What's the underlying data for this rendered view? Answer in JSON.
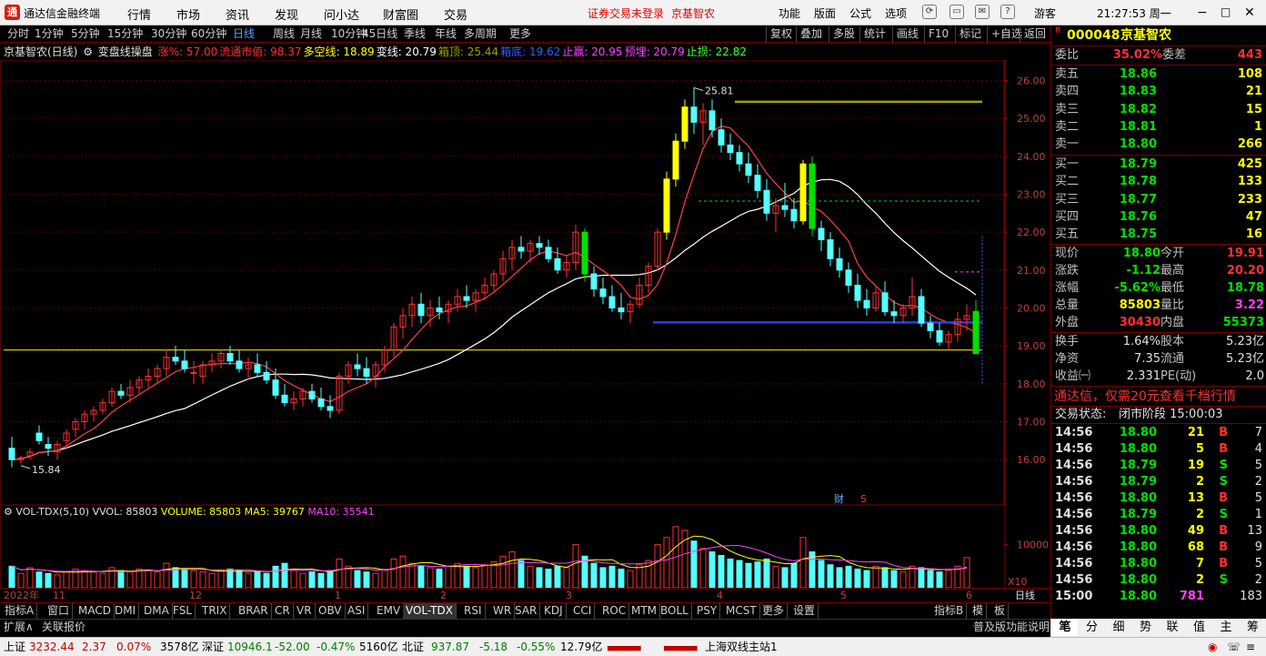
{
  "title_bar": {
    "app_name": "通达信金融终端",
    "menu": [
      "行情",
      "市场",
      "资讯",
      "发现",
      "问小达",
      "财富圈",
      "交易"
    ],
    "login_notice": "证券交易未登录",
    "stock_name": "京基智农",
    "tools": [
      "功能",
      "版面",
      "公式",
      "选项"
    ],
    "user": "游客",
    "clock": "21:27:53 周一"
  },
  "period_bar": {
    "periods": [
      "分时",
      "1分钟",
      "5分钟",
      "15分钟",
      "30分钟",
      "60分钟",
      "日线",
      "周线",
      "月线",
      "10分钟",
      "45日线",
      "季线",
      "年线",
      "多周期",
      "更多"
    ],
    "active": "日线",
    "right_buttons": [
      "复权",
      "叠加",
      "多股",
      "统计",
      "画线",
      "F10",
      "标记",
      "+自选",
      "返回"
    ]
  },
  "indicator_line": {
    "stock_period": "京基智农(日线)",
    "indicator_name": "变盘线操盘",
    "items": [
      {
        "text": "涨%: 57.00",
        "color": "#ff3030"
      },
      {
        "text": "流通市值: 98.37",
        "color": "#ff3030"
      },
      {
        "text": "多空线: 18.89",
        "color": "#ffff00"
      },
      {
        "text": "变线: 20.79",
        "color": "#ffffff"
      },
      {
        "text": "箱顶: 25.44",
        "color": "#a0a000"
      },
      {
        "text": "箱底: 19.62",
        "color": "#3060ff"
      },
      {
        "text": "止赢: 20.95",
        "color": "#ff40ff"
      },
      {
        "text": "预埋: 20.79",
        "color": "#ff40ff"
      },
      {
        "text": "止损: 22.82",
        "color": "#40ff40"
      }
    ]
  },
  "chart_data": {
    "type": "candlestick",
    "y_ticks": [
      "26.00",
      "25.00",
      "24.00",
      "23.00",
      "22.00",
      "21.00",
      "20.00",
      "19.00",
      "18.00",
      "17.00",
      "16.00"
    ],
    "ylim": [
      15.5,
      26.3
    ],
    "x_labels": [
      "2022年",
      "11",
      "12",
      "1",
      "2",
      "3",
      "4",
      "5",
      "6"
    ],
    "annotations": {
      "high_label": "25.81",
      "low_label": "15.84",
      "fin_marker": "财",
      "s_marker": "S"
    },
    "reference_lines": {
      "duokong": 18.89,
      "box_top": 25.44,
      "box_bottom": 19.62,
      "stop_loss": 22.82
    },
    "ohlc": [
      [
        16.3,
        16.6,
        15.8,
        16.0
      ],
      [
        16.0,
        16.1,
        15.9,
        16.05
      ],
      [
        16.1,
        16.3,
        16.0,
        16.2
      ],
      [
        16.7,
        16.9,
        16.4,
        16.5
      ],
      [
        16.4,
        16.6,
        16.1,
        16.3
      ],
      [
        16.2,
        16.5,
        16.0,
        16.4
      ],
      [
        16.5,
        16.8,
        16.3,
        16.7
      ],
      [
        16.8,
        17.1,
        16.6,
        17.0
      ],
      [
        17.0,
        17.3,
        16.8,
        17.2
      ],
      [
        17.2,
        17.4,
        17.0,
        17.3
      ],
      [
        17.3,
        17.6,
        17.2,
        17.5
      ],
      [
        17.5,
        17.9,
        17.4,
        17.8
      ],
      [
        17.8,
        18.0,
        17.6,
        17.7
      ],
      [
        17.7,
        18.1,
        17.5,
        17.9
      ],
      [
        17.9,
        18.2,
        17.7,
        18.1
      ],
      [
        18.1,
        18.4,
        17.9,
        18.2
      ],
      [
        18.2,
        18.5,
        18.0,
        18.4
      ],
      [
        18.4,
        18.9,
        18.2,
        18.7
      ],
      [
        18.7,
        19.0,
        18.5,
        18.6
      ],
      [
        18.6,
        18.9,
        18.3,
        18.4
      ],
      [
        18.3,
        18.6,
        18.0,
        18.3
      ],
      [
        18.2,
        18.6,
        18.0,
        18.5
      ],
      [
        18.5,
        18.8,
        18.3,
        18.6
      ],
      [
        18.6,
        18.9,
        18.4,
        18.8
      ],
      [
        18.8,
        19.0,
        18.5,
        18.6
      ],
      [
        18.6,
        18.9,
        18.3,
        18.4
      ],
      [
        18.4,
        18.7,
        18.1,
        18.5
      ],
      [
        18.5,
        18.8,
        18.2,
        18.3
      ],
      [
        18.3,
        18.6,
        18.0,
        18.1
      ],
      [
        18.1,
        18.4,
        17.6,
        17.7
      ],
      [
        17.7,
        18.0,
        17.4,
        17.5
      ],
      [
        17.5,
        17.8,
        17.3,
        17.6
      ],
      [
        17.6,
        17.9,
        17.4,
        17.8
      ],
      [
        17.8,
        18.0,
        17.5,
        17.6
      ],
      [
        17.6,
        17.9,
        17.3,
        17.4
      ],
      [
        17.4,
        17.7,
        17.1,
        17.3
      ],
      [
        17.3,
        18.3,
        17.2,
        18.2
      ],
      [
        18.2,
        18.6,
        18.0,
        18.5
      ],
      [
        18.5,
        18.8,
        18.2,
        18.4
      ],
      [
        18.4,
        18.7,
        18.0,
        18.2
      ],
      [
        18.2,
        18.6,
        17.9,
        18.5
      ],
      [
        18.5,
        19.0,
        18.3,
        18.9
      ],
      [
        18.9,
        19.6,
        18.7,
        19.5
      ],
      [
        19.5,
        20.0,
        19.2,
        19.8
      ],
      [
        19.8,
        20.3,
        19.5,
        20.1
      ],
      [
        20.1,
        20.4,
        19.6,
        19.8
      ],
      [
        19.8,
        20.2,
        19.5,
        20.0
      ],
      [
        20.0,
        20.3,
        19.7,
        19.9
      ],
      [
        19.9,
        20.2,
        19.6,
        20.1
      ],
      [
        20.1,
        20.5,
        19.9,
        20.3
      ],
      [
        20.3,
        20.6,
        20.0,
        20.2
      ],
      [
        20.2,
        20.5,
        19.9,
        20.4
      ],
      [
        20.4,
        20.8,
        20.2,
        20.6
      ],
      [
        20.6,
        21.0,
        20.4,
        20.9
      ],
      [
        20.9,
        21.5,
        20.7,
        21.3
      ],
      [
        21.3,
        21.8,
        21.0,
        21.6
      ],
      [
        21.6,
        21.9,
        21.3,
        21.5
      ],
      [
        21.5,
        21.8,
        21.2,
        21.7
      ],
      [
        21.7,
        21.9,
        21.4,
        21.6
      ],
      [
        21.6,
        21.8,
        21.2,
        21.3
      ],
      [
        21.3,
        21.6,
        20.9,
        21.0
      ],
      [
        21.0,
        21.4,
        20.8,
        21.2
      ],
      [
        21.2,
        22.2,
        21.0,
        22.0
      ],
      [
        22.0,
        22.1,
        20.7,
        20.9
      ],
      [
        20.9,
        21.1,
        20.3,
        20.5
      ],
      [
        20.5,
        20.8,
        20.1,
        20.3
      ],
      [
        20.3,
        20.6,
        19.9,
        20.0
      ],
      [
        20.0,
        20.4,
        19.7,
        19.9
      ],
      [
        19.9,
        20.2,
        19.6,
        20.1
      ],
      [
        20.1,
        20.8,
        20.0,
        20.6
      ],
      [
        20.6,
        21.2,
        20.4,
        21.1
      ],
      [
        21.1,
        22.1,
        21.0,
        22.0
      ],
      [
        22.0,
        23.6,
        21.8,
        23.4
      ],
      [
        23.4,
        24.6,
        23.2,
        24.4
      ],
      [
        24.4,
        25.5,
        24.2,
        25.3
      ],
      [
        25.3,
        25.81,
        24.6,
        24.9
      ],
      [
        24.9,
        25.4,
        24.3,
        25.2
      ],
      [
        25.2,
        25.5,
        24.5,
        24.7
      ],
      [
        24.7,
        25.0,
        24.1,
        24.3
      ],
      [
        24.3,
        24.6,
        23.9,
        24.1
      ],
      [
        24.1,
        24.3,
        23.6,
        23.8
      ],
      [
        23.8,
        24.1,
        23.3,
        23.5
      ],
      [
        23.5,
        23.8,
        22.9,
        23.1
      ],
      [
        23.1,
        23.4,
        22.3,
        22.5
      ],
      [
        22.5,
        22.9,
        22.0,
        22.7
      ],
      [
        22.7,
        23.3,
        22.4,
        22.6
      ],
      [
        22.6,
        22.9,
        22.1,
        22.3
      ],
      [
        22.3,
        23.9,
        22.2,
        23.8
      ],
      [
        23.8,
        24.0,
        21.9,
        22.1
      ],
      [
        22.1,
        22.3,
        21.5,
        21.8
      ],
      [
        21.8,
        22.0,
        21.1,
        21.3
      ],
      [
        21.3,
        21.6,
        20.8,
        21.0
      ],
      [
        21.0,
        21.2,
        20.4,
        20.6
      ],
      [
        20.6,
        20.9,
        20.0,
        20.2
      ],
      [
        20.2,
        20.5,
        19.8,
        20.0
      ],
      [
        20.0,
        20.6,
        19.9,
        20.4
      ],
      [
        20.4,
        20.7,
        19.8,
        19.9
      ],
      [
        19.9,
        20.2,
        19.6,
        19.8
      ],
      [
        19.8,
        20.1,
        19.6,
        20.0
      ],
      [
        20.0,
        20.8,
        19.8,
        20.3
      ],
      [
        20.3,
        20.5,
        19.5,
        19.6
      ],
      [
        19.6,
        19.8,
        19.2,
        19.4
      ],
      [
        19.4,
        19.6,
        19.0,
        19.1
      ],
      [
        19.1,
        19.4,
        18.9,
        19.3
      ],
      [
        19.3,
        19.9,
        19.1,
        19.7
      ],
      [
        19.7,
        20.1,
        19.4,
        19.8
      ],
      [
        19.91,
        20.2,
        18.78,
        18.8
      ]
    ],
    "volume": [
      30,
      20,
      28,
      22,
      20,
      18,
      22,
      26,
      24,
      22,
      20,
      28,
      24,
      22,
      26,
      24,
      22,
      34,
      28,
      26,
      24,
      22,
      20,
      24,
      26,
      24,
      20,
      22,
      20,
      30,
      34,
      24,
      20,
      22,
      20,
      24,
      40,
      30,
      24,
      22,
      20,
      26,
      40,
      44,
      34,
      30,
      28,
      26,
      30,
      34,
      30,
      28,
      32,
      36,
      44,
      50,
      38,
      30,
      28,
      26,
      30,
      28,
      60,
      44,
      34,
      28,
      30,
      26,
      24,
      32,
      38,
      60,
      70,
      85,
      80,
      65,
      55,
      50,
      45,
      40,
      38,
      34,
      36,
      40,
      30,
      28,
      34,
      70,
      50,
      38,
      32,
      28,
      30,
      26,
      24,
      30,
      28,
      24,
      22,
      30,
      28,
      24,
      22,
      24,
      30,
      42
    ],
    "volume_ticks": [
      "10000",
      "X10"
    ],
    "rise_down_flags": "derived-from-ohlc"
  },
  "volume_line": {
    "name": "VOL-TDX(5,10)",
    "vvol": "VVOL: 85803",
    "volume": "VOLUME: 85803",
    "ma5": "MA5: 39767",
    "ma10": "MA10: 35541"
  },
  "period_label": "日线",
  "bottom_tabs": [
    "指标A",
    "窗口",
    "MACD",
    "DMI",
    "DMA",
    "FSL",
    "TRIX",
    "BRAR",
    "CR",
    "VR",
    "OBV",
    "ASI",
    "EMV",
    "VOL-TDX",
    "RSI",
    "WR",
    "SAR",
    "KDJ",
    "CCI",
    "ROC",
    "MTM",
    "BOLL",
    "PSY",
    "MCST",
    "更多",
    "设置"
  ],
  "bottom_tabs_right": [
    "指标B",
    "模",
    "板"
  ],
  "status_left": [
    "扩展∧",
    "关联报价"
  ],
  "status_right": "普及版功能说明",
  "right_panel": {
    "code": "000048",
    "name": "京基智农",
    "wei_bi_label": "委比",
    "wei_bi": "35.02%",
    "wei_cha_label": "委差",
    "wei_cha": "443",
    "sells": [
      {
        "label": "卖五",
        "price": "18.86",
        "vol": "108"
      },
      {
        "label": "卖四",
        "price": "18.83",
        "vol": "21"
      },
      {
        "label": "卖三",
        "price": "18.82",
        "vol": "15"
      },
      {
        "label": "卖二",
        "price": "18.81",
        "vol": "1"
      },
      {
        "label": "卖一",
        "price": "18.80",
        "vol": "266"
      }
    ],
    "buys": [
      {
        "label": "买一",
        "price": "18.79",
        "vol": "425"
      },
      {
        "label": "买二",
        "price": "18.78",
        "vol": "133"
      },
      {
        "label": "买三",
        "price": "18.77",
        "vol": "233"
      },
      {
        "label": "买四",
        "price": "18.76",
        "vol": "47"
      },
      {
        "label": "买五",
        "price": "18.75",
        "vol": "16"
      }
    ],
    "stats": [
      {
        "l1": "现价",
        "v1": "18.80",
        "c1": "#00e000",
        "l2": "今开",
        "v2": "19.91",
        "c2": "#ff3030"
      },
      {
        "l1": "涨跌",
        "v1": "-1.12",
        "c1": "#00e000",
        "l2": "最高",
        "v2": "20.20",
        "c2": "#ff3030"
      },
      {
        "l1": "涨幅",
        "v1": "-5.62%",
        "c1": "#00e000",
        "l2": "最低",
        "v2": "18.78",
        "c2": "#00e000"
      },
      {
        "l1": "总量",
        "v1": "85803",
        "c1": "#ffff00",
        "l2": "量比",
        "v2": "3.22",
        "c2": "#ff40ff"
      },
      {
        "l1": "外盘",
        "v1": "30430",
        "c1": "#ff3030",
        "l2": "内盘",
        "v2": "55373",
        "c2": "#00e000"
      }
    ],
    "stats2": [
      {
        "l1": "换手",
        "v1": "1.64%",
        "l2": "股本",
        "v2": "5.23亿"
      },
      {
        "l1": "净资",
        "v1": "7.35",
        "l2": "流通",
        "v2": "5.23亿"
      },
      {
        "l1": "收益㈠",
        "v1": "2.331",
        "l2": "PE(动)",
        "v2": "2.0"
      }
    ],
    "promo": "通达信，仅需20元查看千档行情",
    "trade_status_label": "交易状态:",
    "trade_status": "闭市阶段 15:00:03",
    "ticks": [
      {
        "time": "14:56",
        "price": "18.80",
        "vol": "21",
        "bs": "B",
        "n": "7"
      },
      {
        "time": "14:56",
        "price": "18.80",
        "vol": "5",
        "bs": "B",
        "n": "4"
      },
      {
        "time": "14:56",
        "price": "18.79",
        "vol": "19",
        "bs": "S",
        "n": "5"
      },
      {
        "time": "14:56",
        "price": "18.79",
        "vol": "2",
        "bs": "S",
        "n": "2"
      },
      {
        "time": "14:56",
        "price": "18.80",
        "vol": "13",
        "bs": "B",
        "n": "5"
      },
      {
        "time": "14:56",
        "price": "18.79",
        "vol": "2",
        "bs": "S",
        "n": "1"
      },
      {
        "time": "14:56",
        "price": "18.80",
        "vol": "49",
        "bs": "B",
        "n": "13"
      },
      {
        "time": "14:56",
        "price": "18.80",
        "vol": "68",
        "bs": "B",
        "n": "9"
      },
      {
        "time": "14:56",
        "price": "18.80",
        "vol": "7",
        "bs": "B",
        "n": "5"
      },
      {
        "time": "14:56",
        "price": "18.80",
        "vol": "2",
        "bs": "S",
        "n": "2"
      },
      {
        "time": "15:00",
        "price": "18.80",
        "vol": "781",
        "bs": "",
        "n": "183"
      }
    ],
    "bottom_tabs": [
      "笔",
      "分",
      "细",
      "势",
      "联",
      "值",
      "主",
      "筹"
    ]
  },
  "ticker": {
    "sh_label": "上证",
    "sh_val": "3232.44",
    "sh_chg": "2.37",
    "sh_pct": "0.07%",
    "sh_amt": "3578亿",
    "sz_label": "深证",
    "sz_val": "10946.1",
    "sz_chg": "-52.00",
    "sz_pct": "-0.47%",
    "sz_amt": "5160亿",
    "bz_label": "北证",
    "bz_val": "937.87",
    "bz_chg": "-5.18",
    "bz_pct": "-0.55%",
    "bz_amt": "12.79亿",
    "station": "上海双线主站1"
  }
}
